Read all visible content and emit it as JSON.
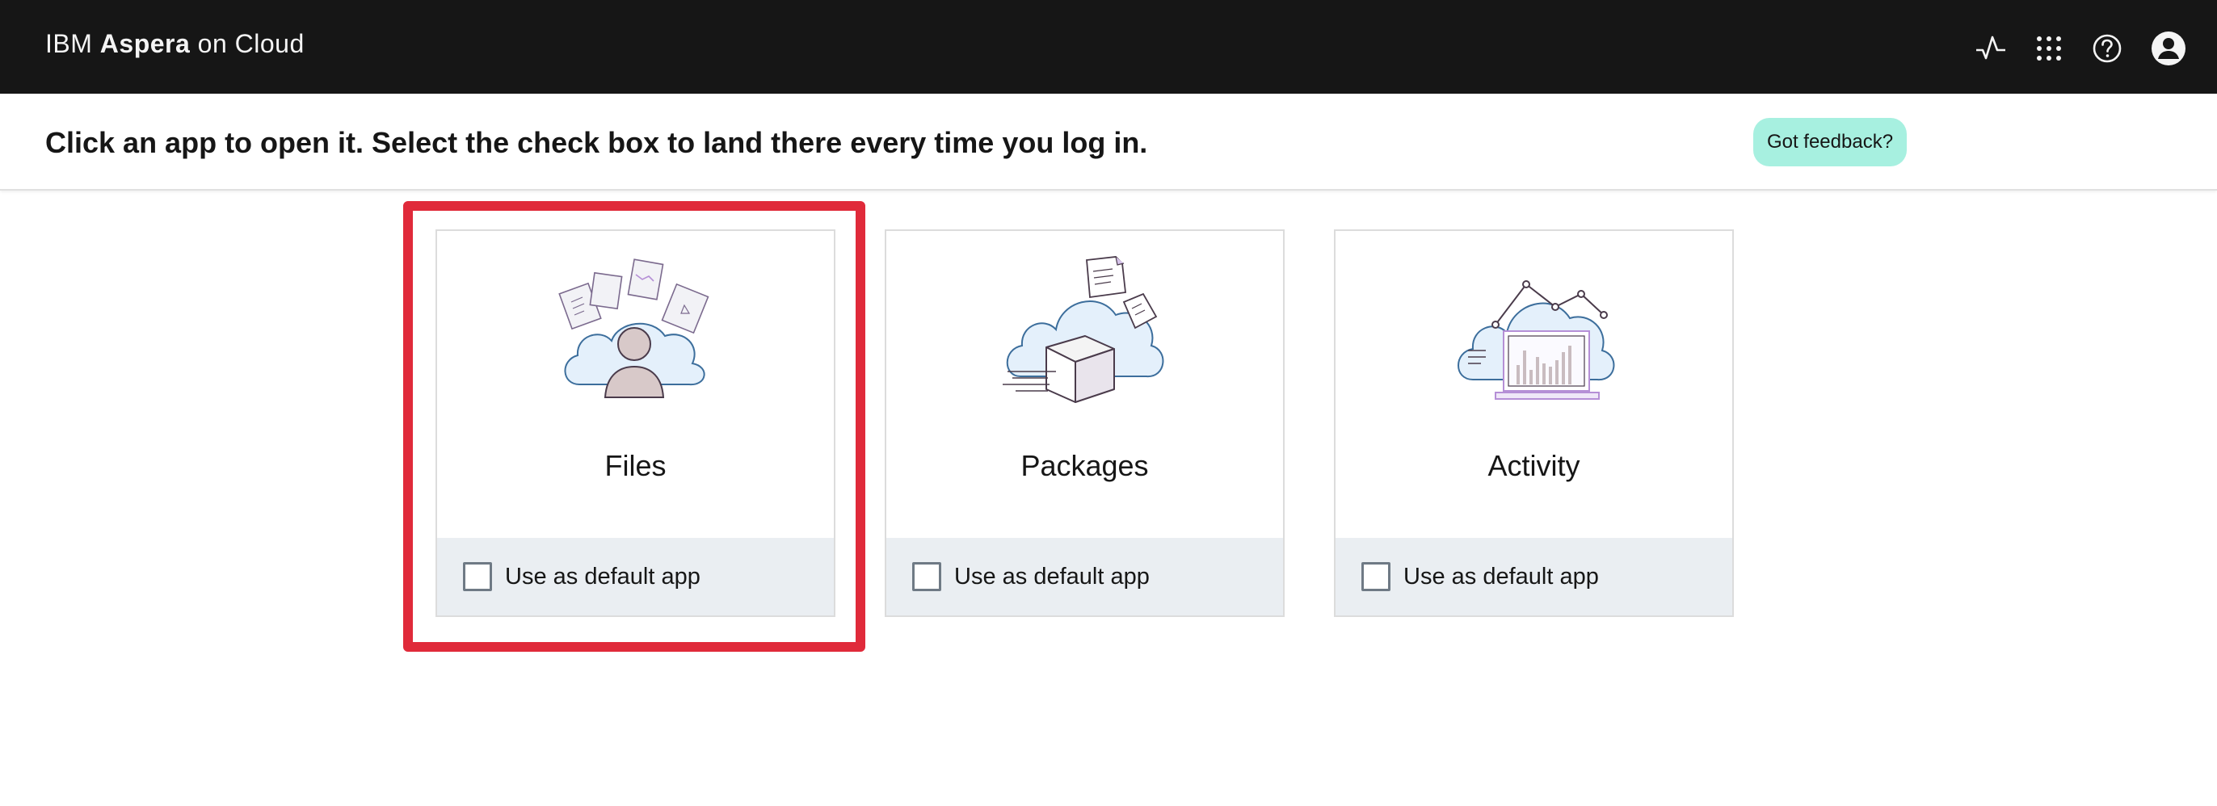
{
  "header": {
    "brand_prefix": "IBM",
    "brand_bold": "Aspera",
    "brand_suffix": "on Cloud",
    "icons": [
      "activity-pulse-icon",
      "app-switcher-icon",
      "help-icon",
      "user-avatar-icon"
    ]
  },
  "subheader": {
    "instruction": "Click an app to open it. Select the check box to land there every time you log in.",
    "feedback_label": "Got feedback?"
  },
  "apps": [
    {
      "name": "Files",
      "checkbox_label": "Use as default app",
      "checked": false,
      "illustration": "files-illustration",
      "highlighted": true
    },
    {
      "name": "Packages",
      "checkbox_label": "Use as default app",
      "checked": false,
      "illustration": "packages-illustration",
      "highlighted": false
    },
    {
      "name": "Activity",
      "checkbox_label": "Use as default app",
      "checked": false,
      "illustration": "activity-illustration",
      "highlighted": false
    }
  ],
  "colors": {
    "topbar": "#161616",
    "highlight": "#e02a3a",
    "feedback_bg": "#a7f0e0",
    "card_footer": "#eaeef2"
  }
}
